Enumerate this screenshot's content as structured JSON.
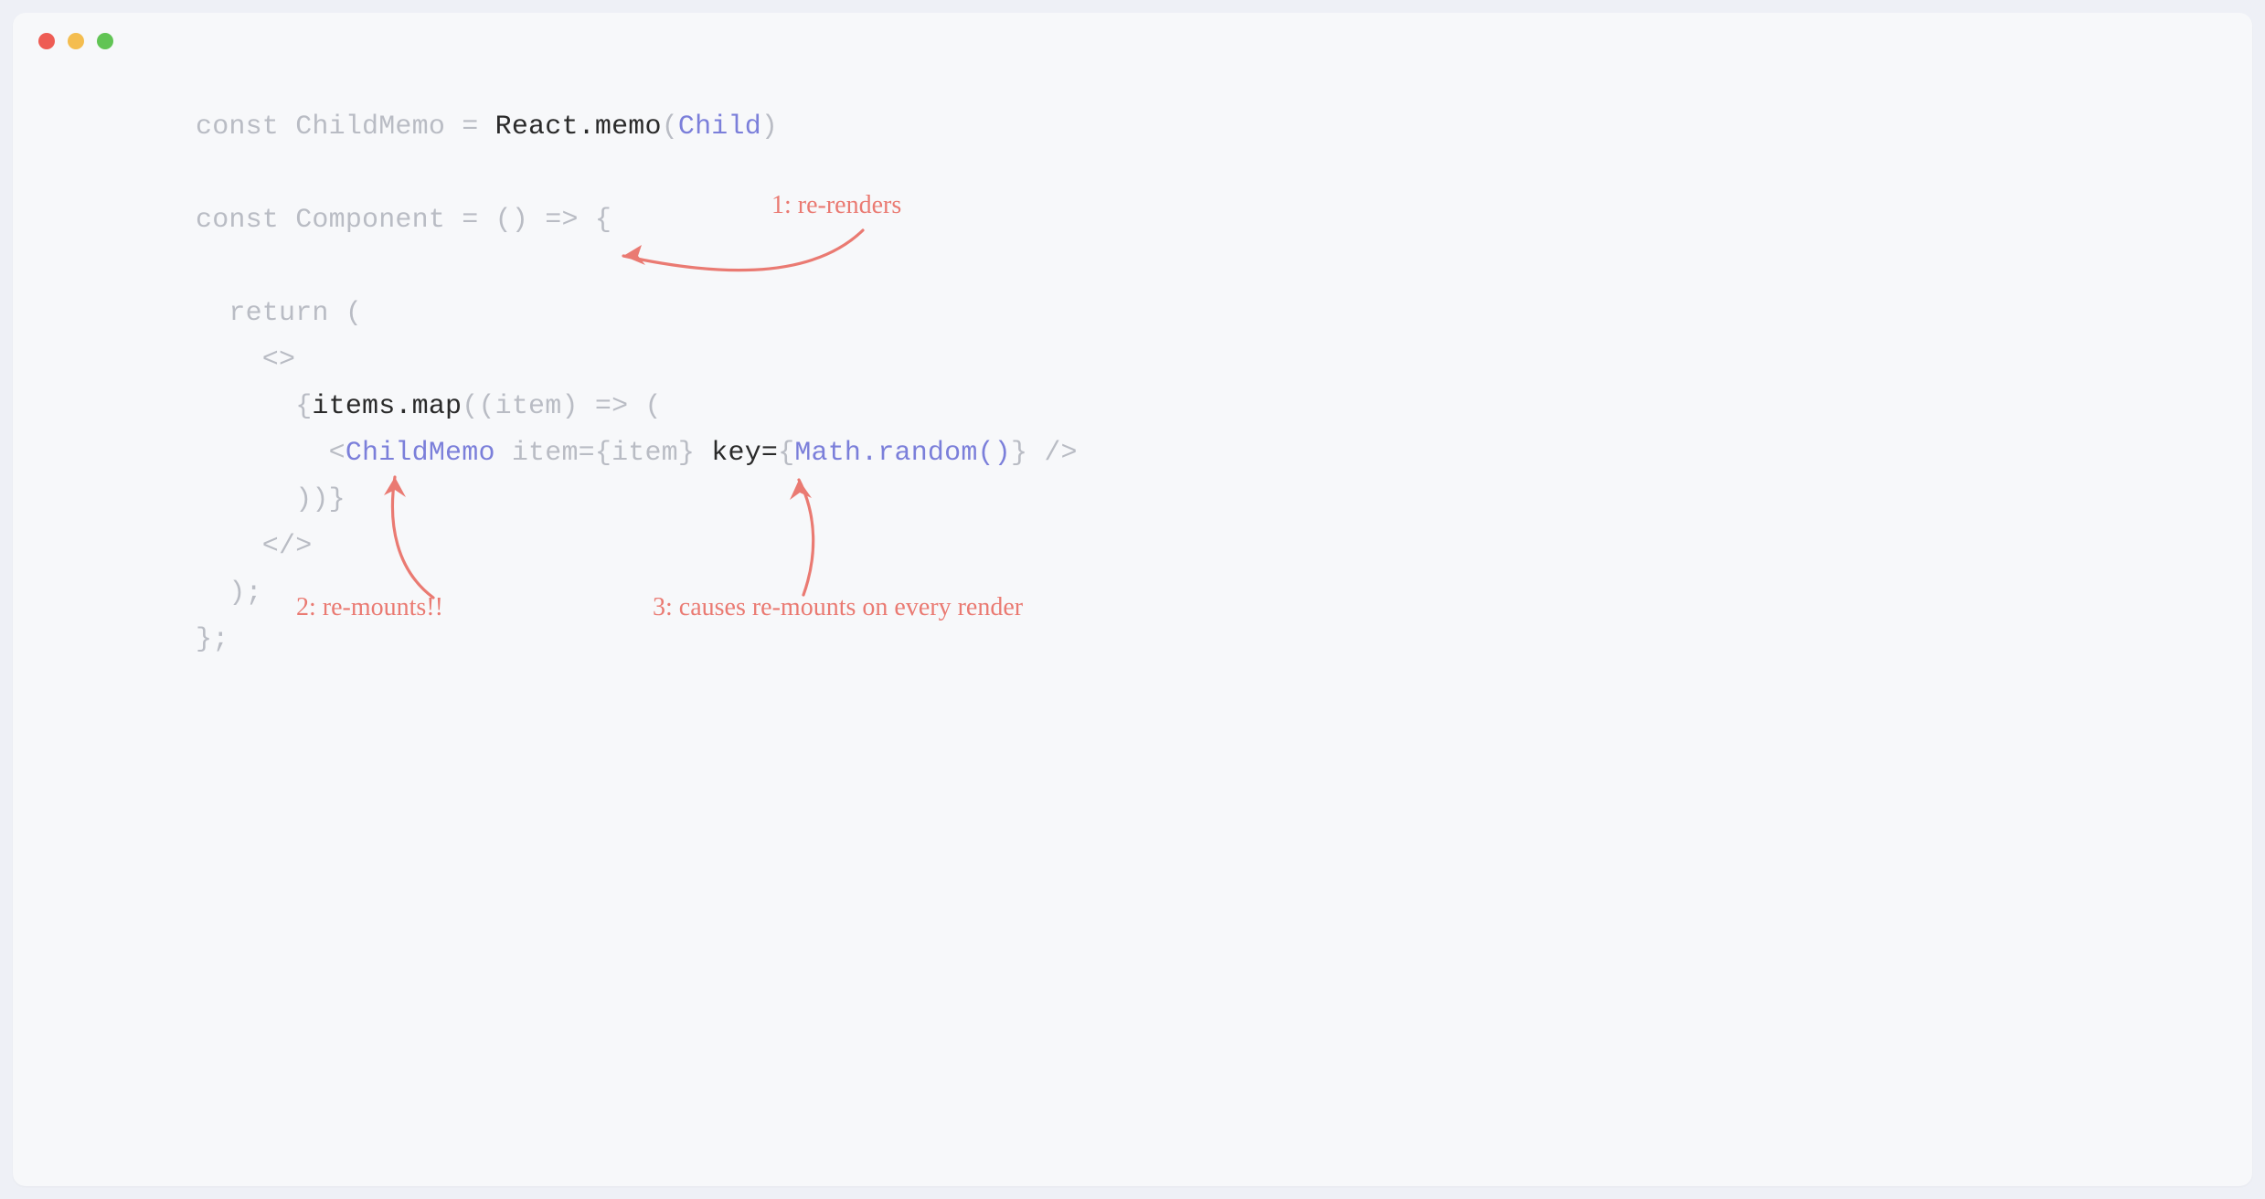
{
  "code": {
    "l1": {
      "a": "const ChildMemo = ",
      "b": "React.memo",
      "c": "(",
      "d": "Child",
      "e": ")"
    },
    "l2": "",
    "l3": "const Component = () => {",
    "l4": "",
    "l5": "  return (",
    "l6": "    <>",
    "l7": {
      "a": "      {",
      "b": "items.map",
      "c": "((item) => ("
    },
    "l8": {
      "a": "        <",
      "b": "ChildMemo",
      "c": " item={item} ",
      "d": "key=",
      "e": "{",
      "f": "Math.random()",
      "g": "}",
      "h": " />"
    },
    "l9": "      ))}",
    "l10": "    </>",
    "l11": "  );",
    "l12": "};"
  },
  "annotations": {
    "a1": "1: re-renders",
    "a2": "2: re-mounts!!",
    "a3": "3: causes re-mounts on every render"
  },
  "colors": {
    "background_outer": "#eef0f6",
    "background_inner": "#f7f8fa",
    "code_faded": "#b9bcc4",
    "code_normal": "#2a2a2a",
    "code_purple": "#7b7fda",
    "annotation": "#ea7a72",
    "traffic_red": "#ee5c54",
    "traffic_yellow": "#f4bd4f",
    "traffic_green": "#61c454"
  }
}
